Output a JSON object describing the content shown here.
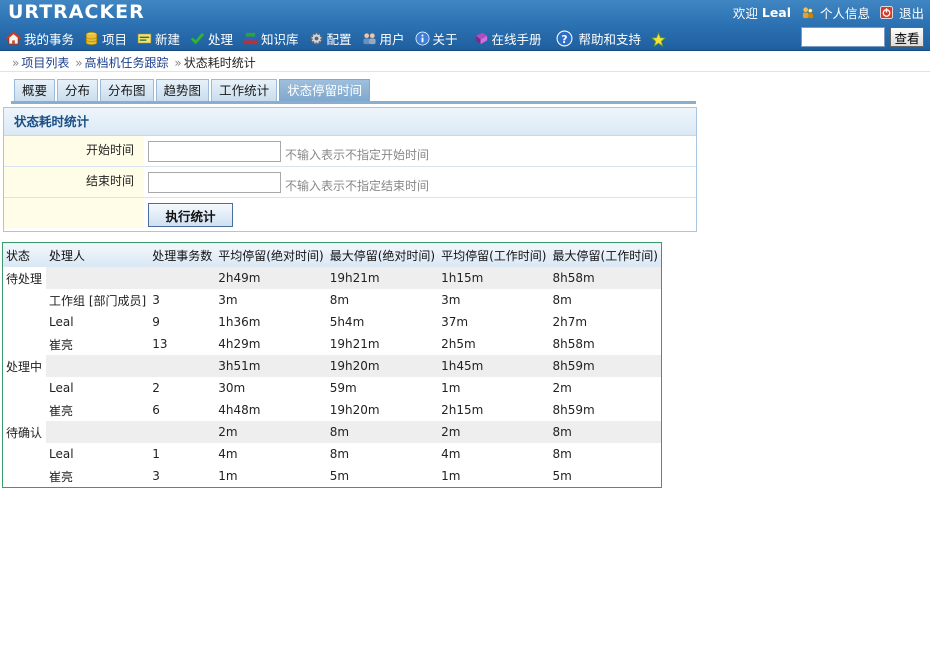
{
  "app": {
    "logo": "URTRACKER",
    "welcome": "欢迎",
    "username": "Leal",
    "profile_label": "个人信息",
    "logout_label": "退出"
  },
  "nav": {
    "items": [
      {
        "label": "我的事务",
        "icon": "home-icon"
      },
      {
        "label": "项目",
        "icon": "database-icon"
      },
      {
        "label": "新建",
        "icon": "new-icon"
      },
      {
        "label": "处理",
        "icon": "check-icon"
      },
      {
        "label": "知识库",
        "icon": "books-icon"
      },
      {
        "label": "配置",
        "icon": "gear-icon"
      },
      {
        "label": "用户",
        "icon": "users-icon"
      },
      {
        "label": "关于",
        "icon": "info-icon"
      },
      {
        "label": "在线手册",
        "icon": "manual-icon"
      },
      {
        "label": "帮助和支持",
        "icon": "help-icon"
      },
      {
        "label": "",
        "icon": "star-icon"
      }
    ],
    "search_value": "",
    "search_button": "查看"
  },
  "breadcrumb": {
    "items": [
      "项目列表",
      "高档机任务跟踪"
    ],
    "current": "状态耗时统计"
  },
  "tabs": [
    "概要",
    "分布",
    "分布图",
    "趋势图",
    "工作统计",
    "状态停留时间"
  ],
  "active_tab": 5,
  "form": {
    "title": "状态耗时统计",
    "start_label": "开始时间",
    "start_value": "",
    "start_hint": "不输入表示不指定开始时间",
    "end_label": "结束时间",
    "end_value": "",
    "end_hint": "不输入表示不指定结束时间",
    "run_button": "执行统计"
  },
  "table": {
    "headers": [
      "状态",
      "处理人",
      "处理事务数",
      "平均停留(绝对时间)",
      "最大停留(绝对时间)",
      "平均停留(工作时间)",
      "最大停留(工作时间)"
    ],
    "rows": [
      {
        "type": "grp",
        "cells": [
          "待处理",
          "",
          "",
          "2h49m",
          "19h21m",
          "1h15m",
          "8h58m"
        ]
      },
      {
        "type": "sub",
        "cells": [
          "",
          "工作组 [部门成员]",
          "3",
          "3m",
          "8m",
          "3m",
          "8m"
        ]
      },
      {
        "type": "sub",
        "cells": [
          "",
          "Leal",
          "9",
          "1h36m",
          "5h4m",
          "37m",
          "2h7m"
        ]
      },
      {
        "type": "sub",
        "cells": [
          "",
          "崔亮",
          "13",
          "4h29m",
          "19h21m",
          "2h5m",
          "8h58m"
        ]
      },
      {
        "type": "grp",
        "cells": [
          "处理中",
          "",
          "",
          "3h51m",
          "19h20m",
          "1h45m",
          "8h59m"
        ]
      },
      {
        "type": "sub",
        "cells": [
          "",
          "Leal",
          "2",
          "30m",
          "59m",
          "1m",
          "2m"
        ]
      },
      {
        "type": "sub",
        "cells": [
          "",
          "崔亮",
          "6",
          "4h48m",
          "19h20m",
          "2h15m",
          "8h59m"
        ]
      },
      {
        "type": "grp",
        "cells": [
          "待确认",
          "",
          "",
          "2m",
          "8m",
          "2m",
          "8m"
        ]
      },
      {
        "type": "sub",
        "cells": [
          "",
          "Leal",
          "1",
          "4m",
          "8m",
          "4m",
          "8m"
        ]
      },
      {
        "type": "sub",
        "cells": [
          "",
          "崔亮",
          "3",
          "1m",
          "5m",
          "1m",
          "5m"
        ]
      }
    ]
  }
}
